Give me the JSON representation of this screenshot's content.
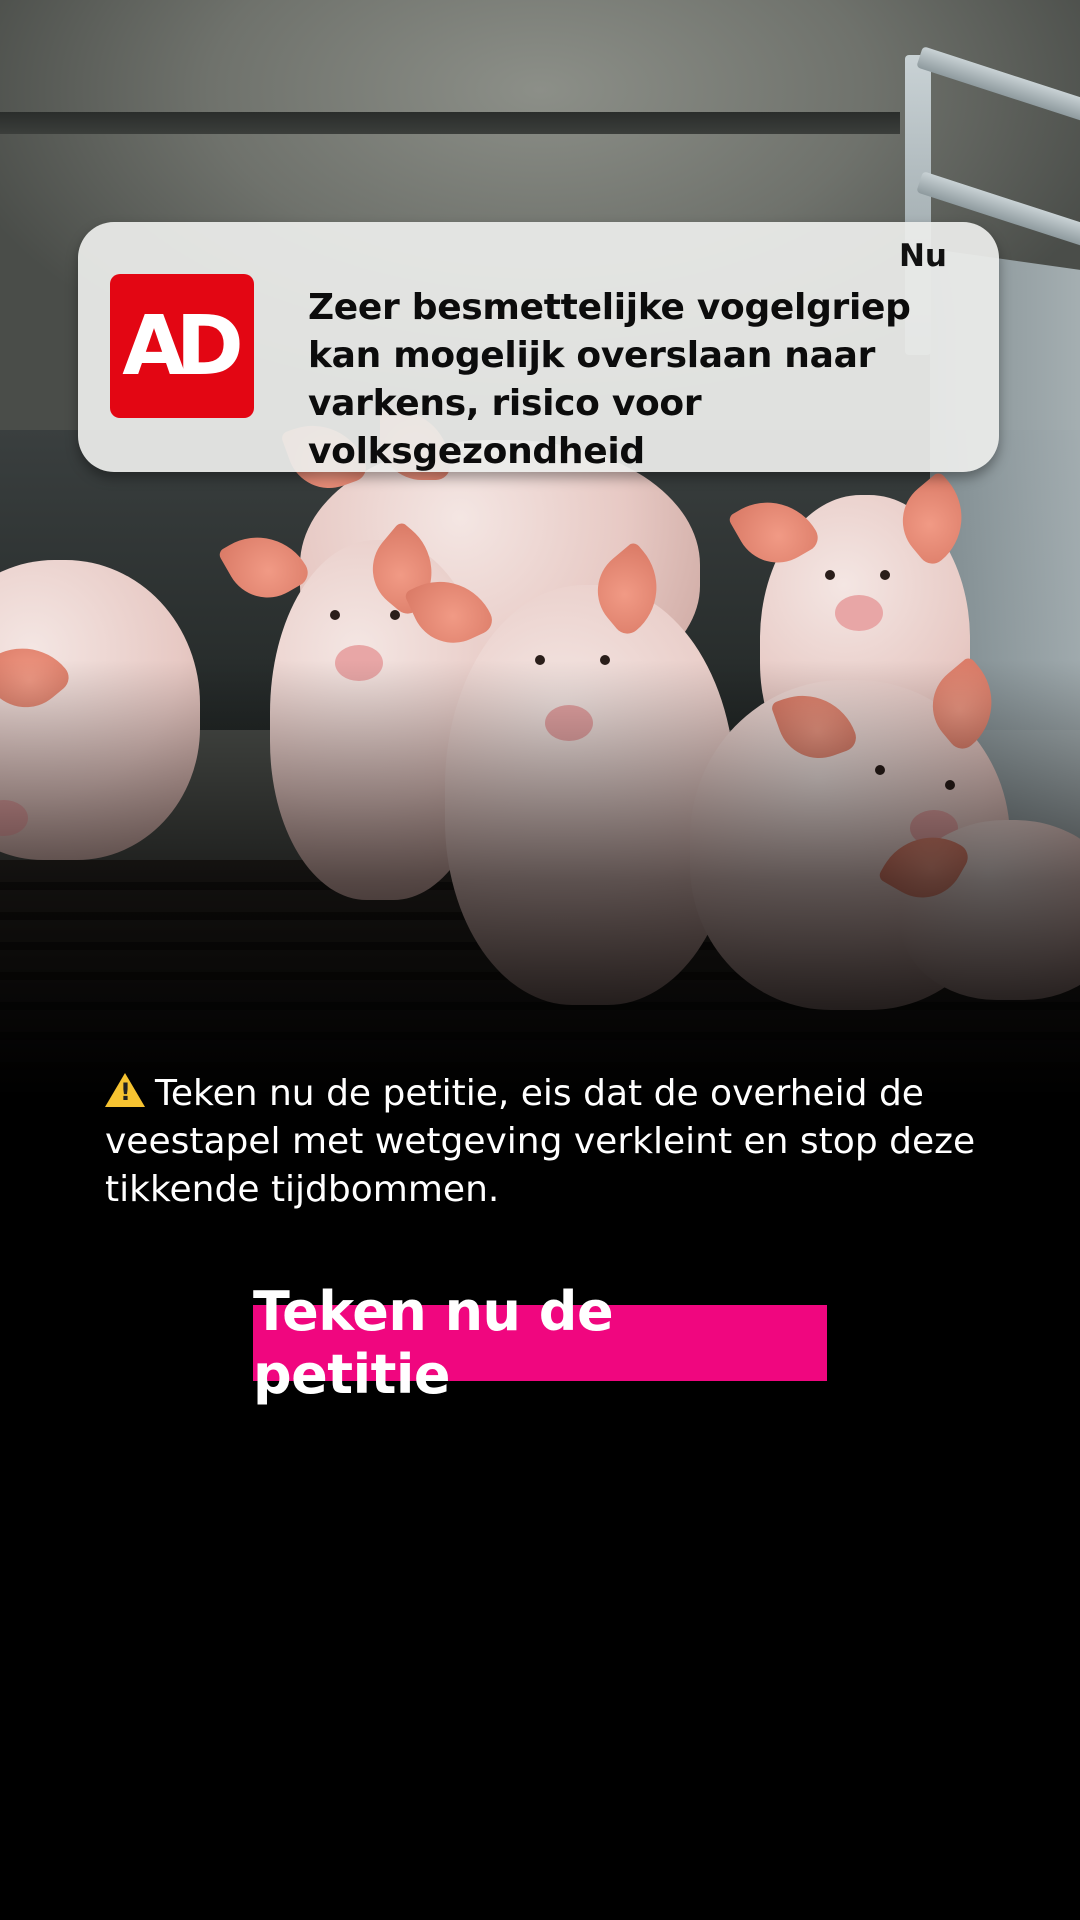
{
  "notification": {
    "app_icon_label": "AD",
    "time": "Nu",
    "headline": "Zeer besmettelijke vogelgriep kan mogelijk overslaan naar varkens, risico voor volksgezondheid"
  },
  "body": {
    "warning_icon": "warning-icon",
    "text": "Teken nu de petitie, eis dat de overheid de veestapel met wetgeving verkleint en stop deze tikkende tijdbommen."
  },
  "cta": {
    "label": "Teken nu de petitie"
  },
  "colors": {
    "background": "#000000",
    "ad_red": "#e30613",
    "cta_pink": "#f0067f",
    "warning_yellow": "#f6c331"
  }
}
